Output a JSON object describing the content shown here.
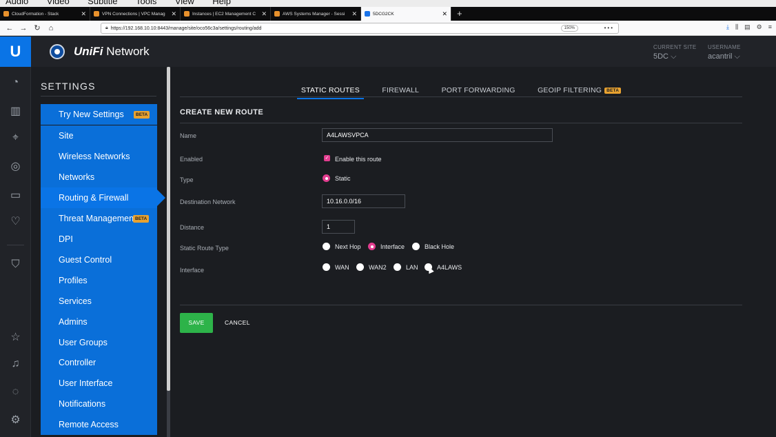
{
  "menubar": [
    "Audio",
    "Video",
    "Subtitle",
    "Tools",
    "View",
    "Help"
  ],
  "browser": {
    "tabs": [
      {
        "title": "CloudFormation - Stack",
        "favicon_color": "#e8912c"
      },
      {
        "title": "VPN Connections | VPC Manag",
        "favicon_color": "#e8912c"
      },
      {
        "title": "Instances | EC2 Management C",
        "favicon_color": "#e8912c"
      },
      {
        "title": "AWS Systems Manager - Sessi",
        "favicon_color": "#e8912c"
      },
      {
        "title": "5DCG2CK",
        "favicon_color": "#1a73e8"
      }
    ],
    "url": "https://192.168.10.10:8443/manage/site/oco56c3a/settings/routing/add",
    "zoom": "150%",
    "more": "•••"
  },
  "header": {
    "brand_bold": "UniFi",
    "brand_rest": " Network",
    "current_site_label": "CURRENT SITE",
    "current_site": "5DC",
    "username_label": "USERNAME",
    "username": "acantril"
  },
  "settings": {
    "title": "SETTINGS",
    "try_new": "Try New Settings",
    "beta": "BETA",
    "group1": [
      "Site",
      "Wireless Networks",
      "Networks",
      "Routing & Firewall",
      "Threat Management",
      "DPI",
      "Guest Control",
      "Profiles",
      "Services",
      "Admins",
      "User Groups"
    ],
    "group2": [
      "Controller",
      "User Interface",
      "Notifications",
      "Remote Access"
    ]
  },
  "tabs": {
    "static_routes": "STATIC ROUTES",
    "firewall": "FIREWALL",
    "port_forwarding": "PORT FORWARDING",
    "geoip": "GEOIP FILTERING",
    "beta": "BETA"
  },
  "form": {
    "title": "CREATE NEW ROUTE",
    "name_label": "Name",
    "name_value": "A4LAWSVPCA",
    "enabled_label": "Enabled",
    "enabled_text": "Enable this route",
    "type_label": "Type",
    "type_value": "Static",
    "dest_label": "Destination Network",
    "dest_value": "10.16.0.0/16",
    "distance_label": "Distance",
    "distance_value": "1",
    "route_type_label": "Static Route Type",
    "route_types": [
      "Next Hop",
      "Interface",
      "Black Hole"
    ],
    "interface_label": "Interface",
    "interfaces": [
      "WAN",
      "WAN2",
      "LAN",
      "A4LAWS"
    ],
    "save": "SAVE",
    "cancel": "CANCEL"
  }
}
